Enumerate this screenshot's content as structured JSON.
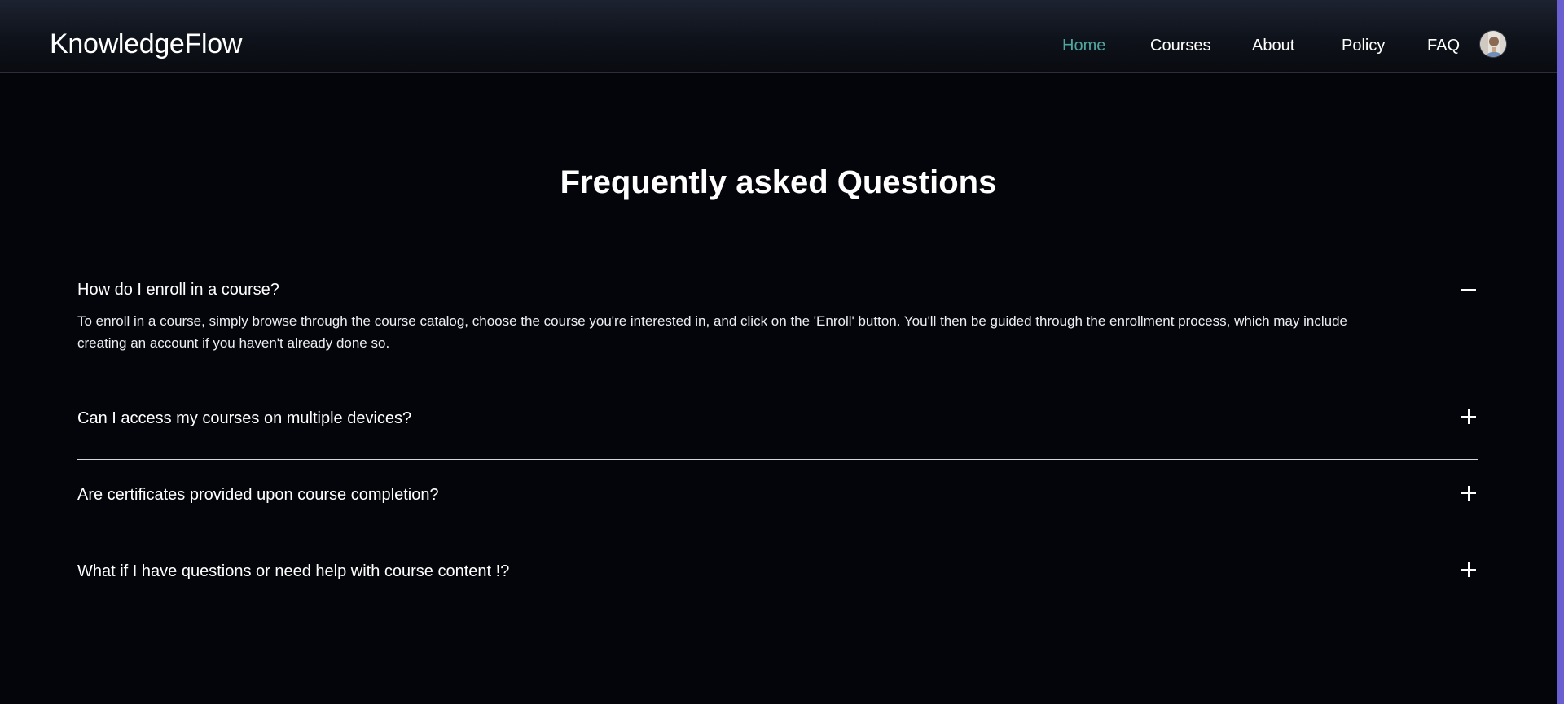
{
  "header": {
    "brand": "KnowledgeFlow",
    "nav": [
      {
        "label": "Home",
        "active": true
      },
      {
        "label": "Courses",
        "active": false
      },
      {
        "label": "About",
        "active": false
      },
      {
        "label": "Policy",
        "active": false
      },
      {
        "label": "FAQ",
        "active": false
      }
    ],
    "avatar_icon": "user-avatar"
  },
  "main": {
    "title": "Frequently asked Questions",
    "faqs": [
      {
        "question": "How do I enroll in a course?",
        "answer_line1": "To enroll in a course, simply browse through the course catalog, choose the course you're interested in, and click on the 'Enroll' button. You'll then be guided through the enrollment process, which may include",
        "answer_line2": "creating an account if you haven't already done so.",
        "expanded": true,
        "toggle_icon": "minus-icon"
      },
      {
        "question": "Can I access my courses on multiple devices?",
        "expanded": false,
        "toggle_icon": "plus-icon"
      },
      {
        "question": "Are certificates provided upon course completion?",
        "expanded": false,
        "toggle_icon": "plus-icon"
      },
      {
        "question": "What if I have questions or need help with course content !?",
        "expanded": false,
        "toggle_icon": "plus-icon"
      }
    ]
  },
  "colors": {
    "background": "#04050a",
    "active_nav": "#4fa7a0",
    "text": "#ffffff",
    "divider": "#d4d6da",
    "scroll_edge": "#6a5fd1"
  }
}
